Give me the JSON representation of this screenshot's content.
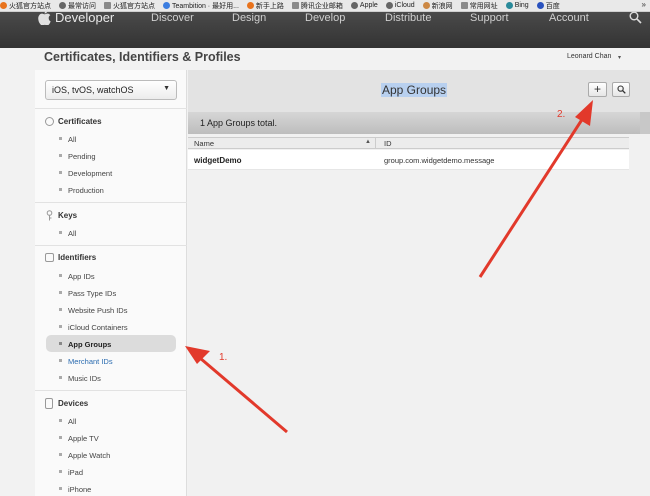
{
  "bookmarks": {
    "items": [
      {
        "label": "火狐官方站点",
        "icon": "firefox-icon"
      },
      {
        "label": "最常访问",
        "icon": "gear-icon"
      },
      {
        "label": "火狐官方站点",
        "icon": "folder-icon"
      },
      {
        "label": "Teambition · 最好用...",
        "icon": "teambition-icon"
      },
      {
        "label": "新手上路",
        "icon": "firefox-icon"
      },
      {
        "label": "腾讯企业邮箱",
        "icon": "folder-icon"
      },
      {
        "label": "Apple",
        "icon": "apple-icon"
      },
      {
        "label": "iCloud",
        "icon": "apple-icon"
      },
      {
        "label": "新浪网",
        "icon": "sina-icon"
      },
      {
        "label": "常用网址",
        "icon": "folder-icon"
      },
      {
        "label": "Bing",
        "icon": "bing-icon"
      },
      {
        "label": "百度",
        "icon": "baidu-icon"
      }
    ],
    "more": "»"
  },
  "topnav": {
    "brand": "Developer",
    "items": [
      "Discover",
      "Design",
      "Develop",
      "Distribute",
      "Support",
      "Account"
    ]
  },
  "header": {
    "title": "Certificates, Identifiers & Profiles",
    "user": "Leonard Chan",
    "user_caret": "▾"
  },
  "sidebar": {
    "platform": "iOS, tvOS, watchOS",
    "sections": [
      {
        "title": "Certificates",
        "items": [
          "All",
          "Pending",
          "Development",
          "Production"
        ]
      },
      {
        "title": "Keys",
        "items": [
          "All"
        ]
      },
      {
        "title": "Identifiers",
        "items": [
          "App IDs",
          "Pass Type IDs",
          "Website Push IDs",
          "iCloud Containers",
          "App Groups",
          "Merchant IDs",
          "Music IDs"
        ]
      },
      {
        "title": "Devices",
        "items": [
          "All",
          "Apple TV",
          "Apple Watch",
          "iPad",
          "iPhone"
        ]
      }
    ],
    "selected": "App Groups"
  },
  "main": {
    "title": "App Groups",
    "add_label": "+",
    "total": "1  App Groups total.",
    "columns": [
      "Name",
      "ID"
    ],
    "rows": [
      {
        "name": "widgetDemo",
        "id": "group.com.widgetdemo.message"
      }
    ]
  },
  "annotations": {
    "label1": "1.",
    "label2": "2.",
    "color": "#e2392b"
  }
}
